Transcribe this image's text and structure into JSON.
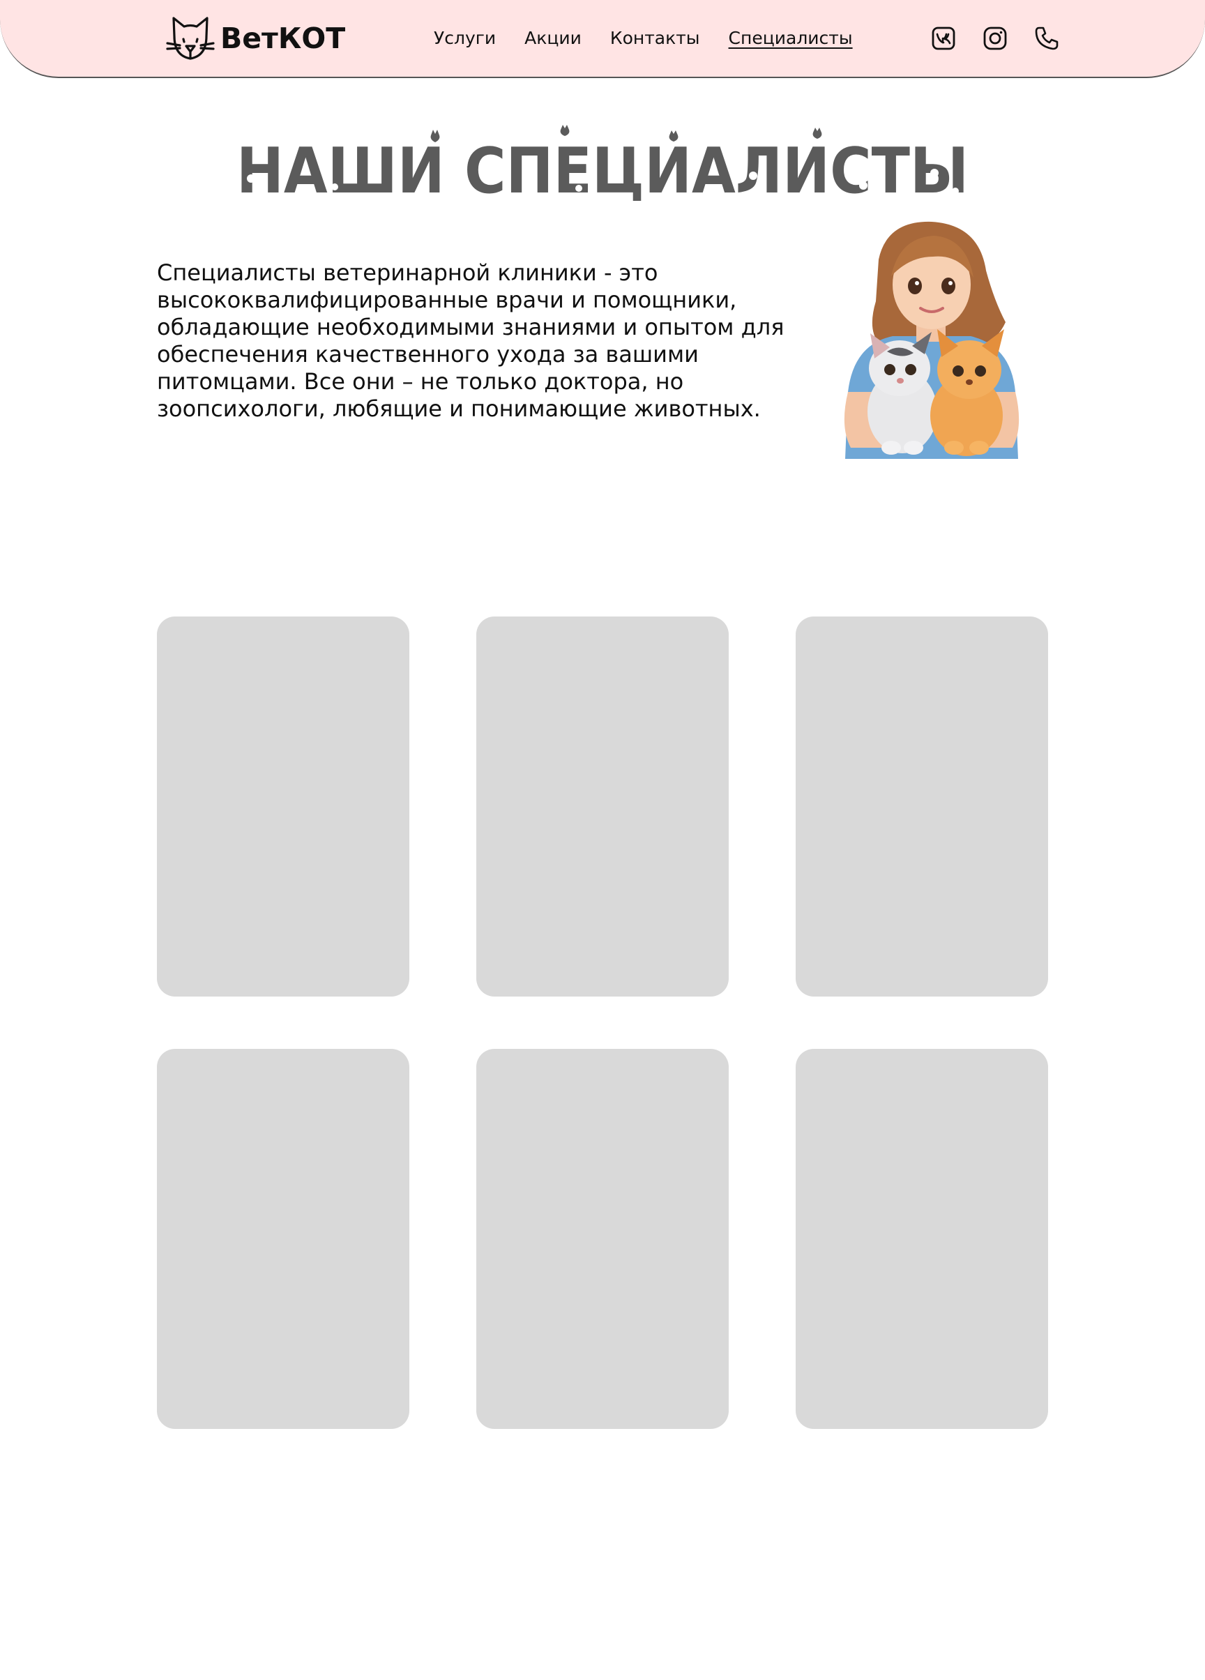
{
  "header": {
    "logo_text": "ВетКОТ",
    "logo_icon": "cat-head-icon",
    "nav": [
      {
        "label": "Услуги",
        "active": false
      },
      {
        "label": "Акции",
        "active": false
      },
      {
        "label": "Контакты",
        "active": false
      },
      {
        "label": "Специалисты",
        "active": true
      }
    ],
    "socials": [
      {
        "icon": "vk-icon"
      },
      {
        "icon": "instagram-icon"
      },
      {
        "icon": "phone-icon"
      }
    ],
    "background_color": "#ffe4e4"
  },
  "main": {
    "title": "НАШИ СПЕЦИАЛИСТЫ",
    "title_color": "#5b5b5b",
    "intro": "Специалисты ветеринарной клиники - это высококвалифицированные врачи и помощники, обладающие необходимыми знаниями и опытом для обеспечения качественного ухода за вашими питомцами. Все они – не только доктора, но зоопсихологи, любящие и понимающие животных.",
    "hero_image": "vet-with-kittens-illustration",
    "card_color": "#d9d9d9",
    "cards": [
      {
        "placeholder": true
      },
      {
        "placeholder": true
      },
      {
        "placeholder": true
      },
      {
        "placeholder": true
      },
      {
        "placeholder": true
      },
      {
        "placeholder": true
      }
    ]
  }
}
